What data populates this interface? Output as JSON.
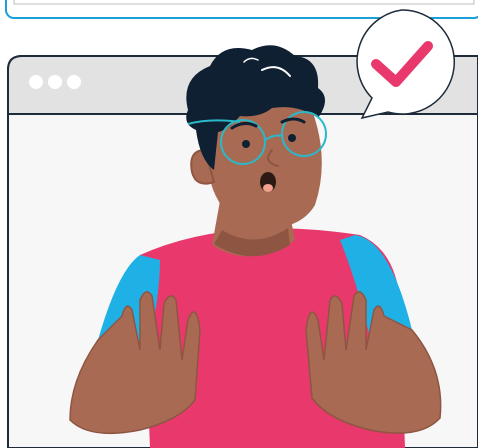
{
  "colors": {
    "background": "#ffffff",
    "window_frame": "#1d2b3a",
    "window_titlebar": "#e2e2e2",
    "window_body": "#f7f7f7",
    "window_dots": "#ffffff",
    "top_bar_outline": "#1a9fd8",
    "speech_bubble": "#ffffff",
    "checkmark": "#e9386c",
    "hair": "#0f2033",
    "skin": "#a86a52",
    "skin_shadow": "#8e5642",
    "glasses": "#2bb8c7",
    "shirt": "#e9386c",
    "sleeves": "#1fb0e6",
    "mouth": "#2b1a14",
    "tongue": "#f2a08f"
  },
  "icons": {
    "checkmark": "checkmark-icon",
    "window_controls": "window-dots-icon"
  },
  "scene": {
    "description_visible_text": ""
  }
}
